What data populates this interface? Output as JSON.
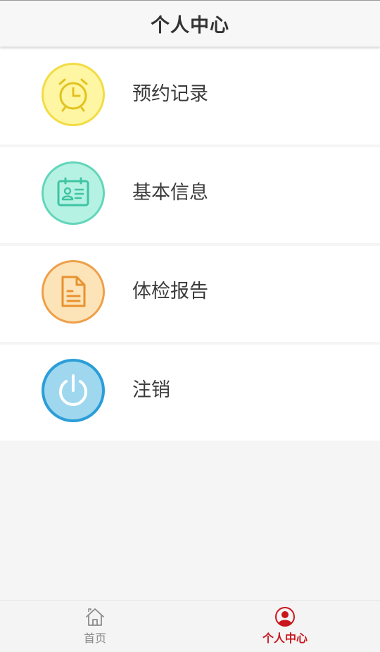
{
  "header": {
    "title": "个人中心"
  },
  "menu": {
    "items": [
      {
        "label": "预约记录",
        "icon": "alarm-clock-icon",
        "circle_color": "#fff6a3",
        "border_color": "#f2dc45"
      },
      {
        "label": "基本信息",
        "icon": "id-card-icon",
        "circle_color": "#b6f2e3",
        "border_color": "#63d6ba"
      },
      {
        "label": "体检报告",
        "icon": "document-icon",
        "circle_color": "#fde3b8",
        "border_color": "#eea04a"
      },
      {
        "label": "注销",
        "icon": "power-icon",
        "circle_color": "#9ed7ee",
        "border_color": "#2b9ed8"
      }
    ]
  },
  "tabbar": {
    "tabs": [
      {
        "label": "首页",
        "icon": "home-icon",
        "active": false
      },
      {
        "label": "个人中心",
        "icon": "user-icon",
        "active": true
      }
    ],
    "active_color": "#c8161d",
    "inactive_color": "#8a8a8a"
  }
}
